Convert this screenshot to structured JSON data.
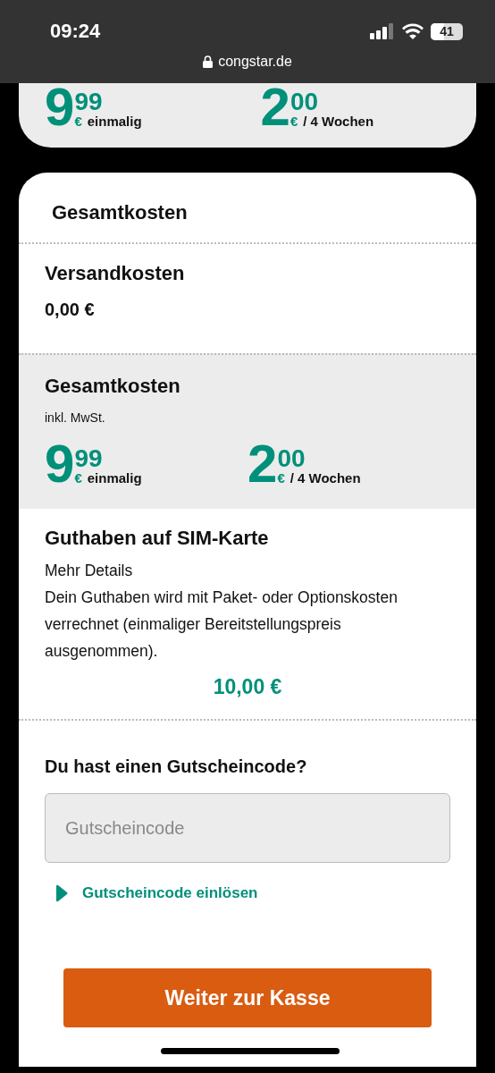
{
  "status_bar": {
    "time": "09:24",
    "battery": "41",
    "url": "congstar.de"
  },
  "top_card": {
    "prices": [
      {
        "main": "9",
        "cents": "99",
        "currency": "€",
        "period": "einmalig"
      },
      {
        "main": "2",
        "cents": "00",
        "currency": "€",
        "period": "/ 4 Wochen"
      }
    ]
  },
  "summary": {
    "title": "Gesamtkosten",
    "shipping": {
      "label": "Versandkosten",
      "value": "0,00 €"
    },
    "total": {
      "label": "Gesamtkosten",
      "note": "inkl. MwSt.",
      "prices": [
        {
          "main": "9",
          "cents": "99",
          "currency": "€",
          "period": "einmalig"
        },
        {
          "main": "2",
          "cents": "00",
          "currency": "€",
          "period": "/ 4 Wochen"
        }
      ]
    },
    "credit": {
      "label": "Guthaben auf SIM-Karte",
      "details": "Mehr Details",
      "text": "Dein Guthaben wird mit Paket- oder Optionskosten verrechnet (einmaliger Bereitstellungspreis ausgenommen).",
      "amount": "10,00 €"
    }
  },
  "voucher": {
    "question": "Du hast einen Gutscheincode?",
    "placeholder": "Gutscheincode",
    "link": "Gutscheincode einlösen"
  },
  "checkout_button": "Weiter zur Kasse"
}
